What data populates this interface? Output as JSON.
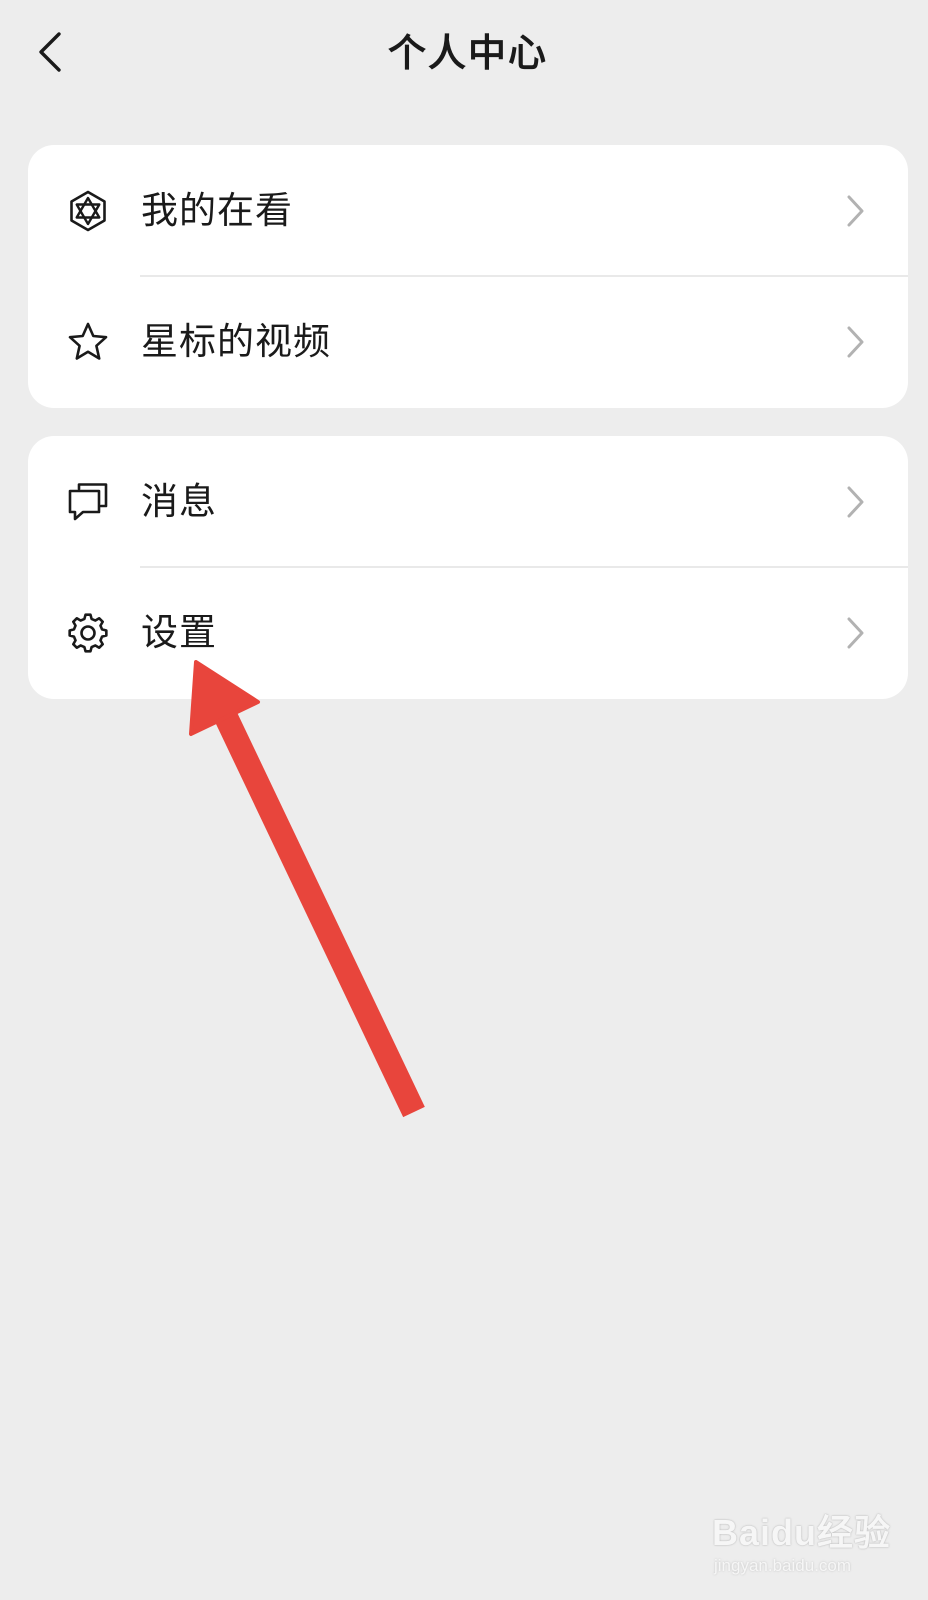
{
  "header": {
    "title": "个人中心",
    "back_icon": "chevron-left-icon"
  },
  "groups": [
    {
      "items": [
        {
          "label": "我的在看",
          "icon": "hexagon-star-icon"
        },
        {
          "label": "星标的视频",
          "icon": "star-icon"
        }
      ]
    },
    {
      "items": [
        {
          "label": "消息",
          "icon": "chat-bubbles-icon"
        },
        {
          "label": "设置",
          "icon": "gear-icon"
        }
      ]
    }
  ],
  "colors": {
    "background": "#ededed",
    "card": "#ffffff",
    "text": "#1a1a1a",
    "chevron": "#b2b2b2",
    "annotation_arrow": "#e8453c"
  },
  "watermark": {
    "brand": "Baidu经验",
    "url": "jingyan.baidu.com"
  }
}
